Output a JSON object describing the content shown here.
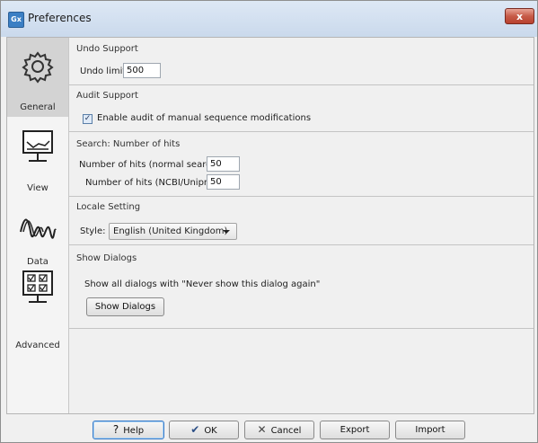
{
  "window": {
    "title": "Preferences",
    "app_icon": "Gx",
    "close_glyph": "x"
  },
  "sidebar": {
    "items": [
      {
        "label": "General",
        "icon": "gear-icon",
        "selected": true
      },
      {
        "label": "View",
        "icon": "monitor-chart-icon",
        "selected": false
      },
      {
        "label": "Data",
        "icon": "sequence-wave-icon",
        "selected": false
      },
      {
        "label": "Advanced",
        "icon": "checklist-monitor-icon",
        "selected": false
      }
    ]
  },
  "sections": {
    "undo": {
      "title": "Undo Support",
      "limit_label": "Undo limit:",
      "limit_value": "500"
    },
    "audit": {
      "title": "Audit Support",
      "checkbox_label": "Enable audit of manual sequence modifications",
      "checked": true
    },
    "search": {
      "title": "Search: Number of hits",
      "normal_label": "Number of hits (normal search):",
      "normal_value": "50",
      "ncbi_label": "Number of hits (NCBI/Uniprot):",
      "ncbi_value": "50"
    },
    "locale": {
      "title": "Locale Setting",
      "style_label": "Style:",
      "style_value": "English (United Kingdom)"
    },
    "dialogs": {
      "title": "Show Dialogs",
      "description": "Show all dialogs with \"Never show this dialog again\"",
      "button_label": "Show Dialogs"
    }
  },
  "buttons": {
    "help": {
      "label": "Help",
      "glyph": "?"
    },
    "ok": {
      "label": "OK",
      "glyph": "✔"
    },
    "cancel": {
      "label": "Cancel",
      "glyph": "✕"
    },
    "export": {
      "label": "Export"
    },
    "import": {
      "label": "Import"
    }
  },
  "colors": {
    "selected_nav": "#d3d3d3",
    "checkbox_fill": "#dfeaf7",
    "close_button": "#c75b48"
  }
}
